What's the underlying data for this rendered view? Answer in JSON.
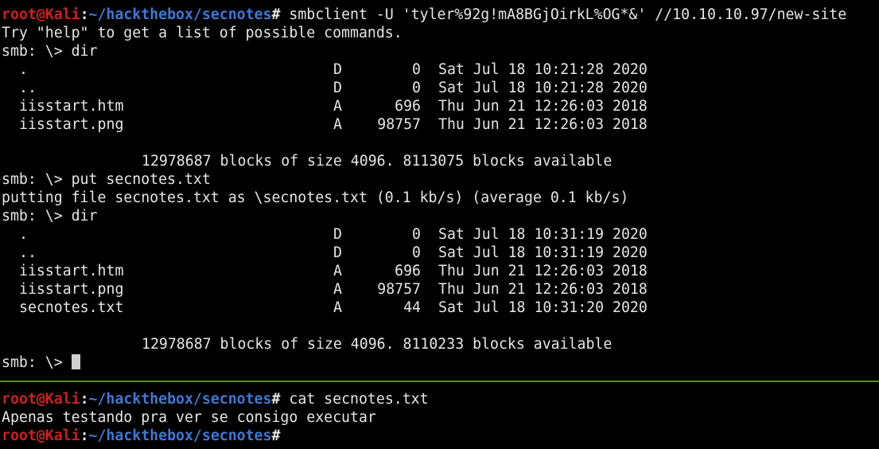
{
  "theme": {
    "background": "#000000",
    "foreground": "#e6e6e6",
    "user_color": "#d01f1f",
    "path_color": "#3e78d6",
    "divider_color": "#4e9a06"
  },
  "prompt": {
    "user_host": "root@Kali",
    "colon": ":",
    "path": "~/hackthebox/secnotes",
    "symbol": "# "
  },
  "top_pane": {
    "command1": "smbclient -U 'tyler%92g!mA8BGjOirkL%OG*&' //10.10.10.97/new-site",
    "help_text": "Try \"help\" to get a list of possible commands.",
    "smb_dir_1": "smb: \\> dir",
    "listing1": [
      {
        "name": ".",
        "attr": "D",
        "size": "0",
        "date": "Sat Jul 18 10:21:28 2020"
      },
      {
        "name": "..",
        "attr": "D",
        "size": "0",
        "date": "Sat Jul 18 10:21:28 2020"
      },
      {
        "name": "iisstart.htm",
        "attr": "A",
        "size": "696",
        "date": "Thu Jun 21 12:26:03 2018"
      },
      {
        "name": "iisstart.png",
        "attr": "A",
        "size": "98757",
        "date": "Thu Jun 21 12:26:03 2018"
      }
    ],
    "summary1": "12978687 blocks of size 4096. 8113075 blocks available",
    "smb_put": "smb: \\> put secnotes.txt",
    "put_output": "putting file secnotes.txt as \\secnotes.txt (0.1 kb/s) (average 0.1 kb/s)",
    "smb_dir_2": "smb: \\> dir",
    "listing2": [
      {
        "name": ".",
        "attr": "D",
        "size": "0",
        "date": "Sat Jul 18 10:31:19 2020"
      },
      {
        "name": "..",
        "attr": "D",
        "size": "0",
        "date": "Sat Jul 18 10:31:19 2020"
      },
      {
        "name": "iisstart.htm",
        "attr": "A",
        "size": "696",
        "date": "Thu Jun 21 12:26:03 2018"
      },
      {
        "name": "iisstart.png",
        "attr": "A",
        "size": "98757",
        "date": "Thu Jun 21 12:26:03 2018"
      },
      {
        "name": "secnotes.txt",
        "attr": "A",
        "size": "44",
        "date": "Sat Jul 18 10:31:20 2020"
      }
    ],
    "summary2": "12978687 blocks of size 4096. 8110233 blocks available",
    "smb_prompt": "smb: \\> "
  },
  "bottom_pane": {
    "command": "cat secnotes.txt",
    "output": "Apenas testando pra ver se consigo executar"
  }
}
